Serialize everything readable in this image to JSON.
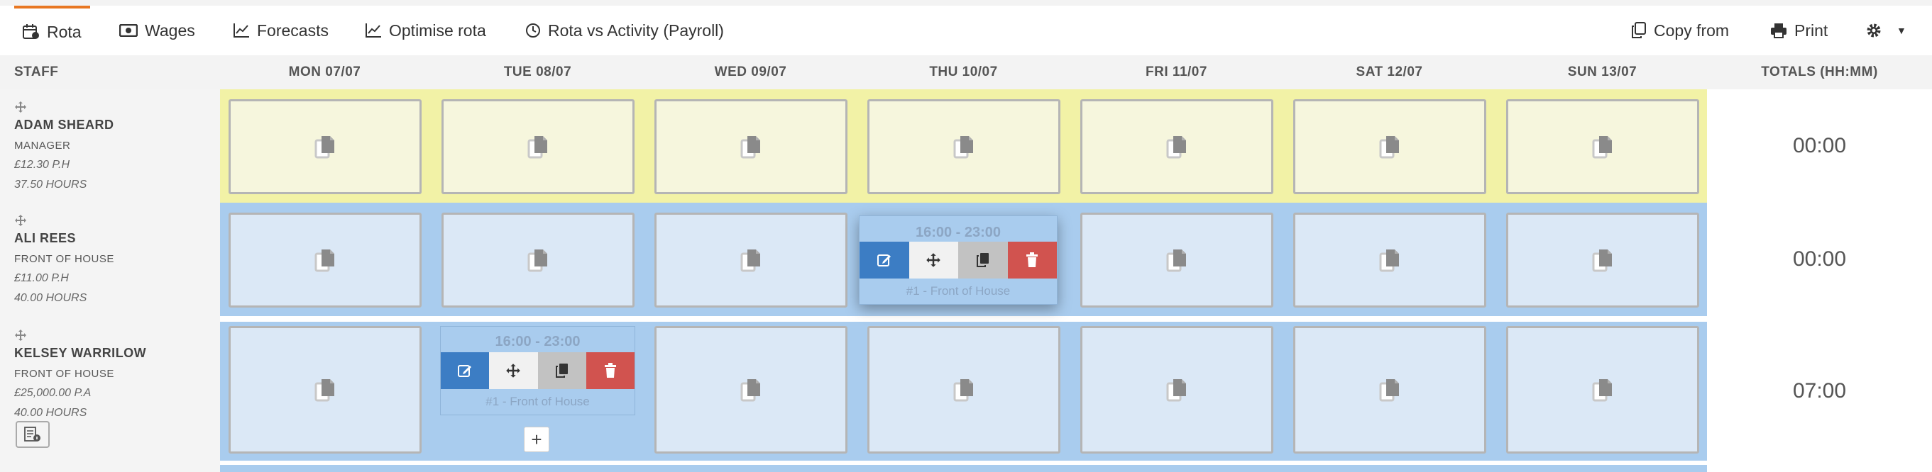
{
  "nav": {
    "tabs": [
      {
        "label": "Rota",
        "icon": "calendar-icon",
        "active": true
      },
      {
        "label": "Wages",
        "icon": "money-icon"
      },
      {
        "label": "Forecasts",
        "icon": "line-chart-icon"
      },
      {
        "label": "Optimise rota",
        "icon": "line-chart-icon"
      },
      {
        "label": "Rota vs Activity (Payroll)",
        "icon": "clock-icon"
      }
    ],
    "copy_from": "Copy from",
    "print": "Print"
  },
  "header": {
    "staff": "STAFF",
    "days": [
      "MON 07/07",
      "TUE 08/07",
      "WED 09/07",
      "THU 10/07",
      "FRI 11/07",
      "SAT 12/07",
      "SUN 13/07"
    ],
    "totals": "TOTALS (HH:MM)"
  },
  "staff": [
    {
      "name": "ADAM SHEARD",
      "role": "MANAGER",
      "rate": "£12.30 P.H",
      "hours": "37.50 HOURS",
      "total": "00:00"
    },
    {
      "name": "ALI REES",
      "role": "FRONT OF HOUSE",
      "rate": "£11.00 P.H",
      "hours": "40.00 HOURS",
      "total": "00:00"
    },
    {
      "name": "KELSEY WARRILOW",
      "role": "FRONT OF HOUSE",
      "rate": "£25,000.00 P.A",
      "hours": "40.00 HOURS",
      "total": "07:00"
    }
  ],
  "shifts": [
    {
      "time": "16:00 - 23:00",
      "position": "#1 - Front of House"
    },
    {
      "time": "16:00 - 23:00",
      "position": "#1 - Front of House"
    }
  ],
  "colors": {
    "accent": "#e87722",
    "manager_row": "#f2f2a6",
    "foh_row": "#a9ccee",
    "edit": "#3c7dc4",
    "delete": "#d1534f"
  }
}
